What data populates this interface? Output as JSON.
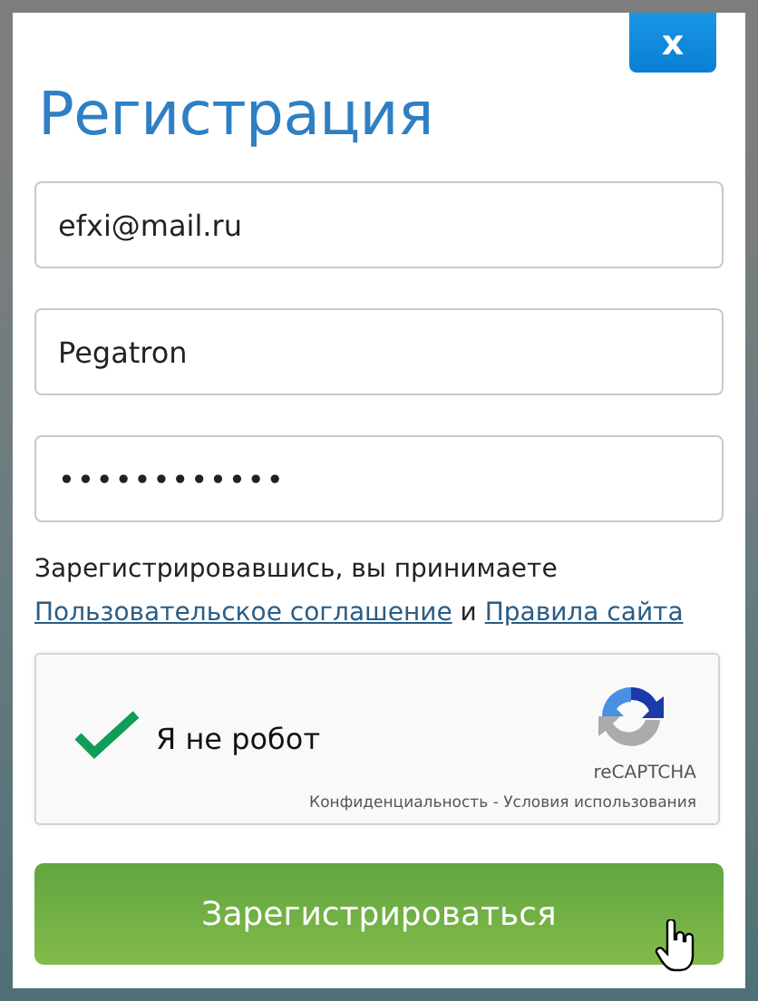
{
  "dialog": {
    "close": "x",
    "title": "Регистрация"
  },
  "fields": [
    {
      "value": "efxi@mail.ru"
    },
    {
      "value": "Pegatron"
    },
    {
      "value": "••••••••••••"
    }
  ],
  "terms": {
    "text": "Зарегистрировавшись, вы принимаете",
    "link_1": "Пользовательское соглашение",
    "joiner": "и",
    "link_2": "Правила сайта"
  },
  "captcha": {
    "label": "Я не робот",
    "checked": true,
    "brand": "reCAPTCHA",
    "privacy": "Конфиденциальность",
    "separator": "-",
    "terms": "Условия использования"
  },
  "submit": "Зарегистрироваться"
}
